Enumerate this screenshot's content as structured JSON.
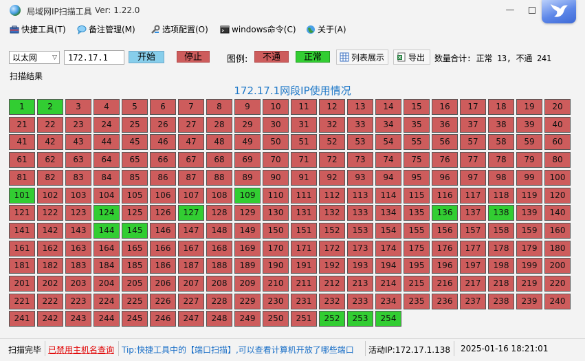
{
  "window": {
    "title": "局域网IP扫描工具",
    "version": "Ver: 1.22.0",
    "minimize_glyph": "—"
  },
  "menu": [
    {
      "label": "快捷工具(T)",
      "icon": "toolbox-icon"
    },
    {
      "label": "备注管理(M)",
      "icon": "chat-bubble-icon"
    },
    {
      "label": "选项配置(O)",
      "icon": "wrench-icon"
    },
    {
      "label": "windows命令(C)",
      "icon": "console-icon"
    },
    {
      "label": "关于(A)",
      "icon": "globe-icon"
    }
  ],
  "toolbar": {
    "adapter_selected": "以太网",
    "ip_value": "172.17.1",
    "start_label": "开始",
    "stop_label": "停止",
    "legend_label": "图例:",
    "legend_down": "不通",
    "legend_up": "正常",
    "list_view_label": "列表展示",
    "export_label": "导出",
    "count_text": "数量合计: 正常 13, 不通 241"
  },
  "results": {
    "section_label": "扫描结果",
    "grid_title": "172.17.1网段IP使用情况",
    "total": 254,
    "up_hosts": [
      1,
      2,
      101,
      109,
      124,
      127,
      136,
      138,
      144,
      145,
      252,
      253,
      254
    ]
  },
  "colors": {
    "up": "#32cd32",
    "down": "#cd5c5c",
    "start_button": "#87ceeb",
    "title_blue": "#1e78c8"
  },
  "status": {
    "state": "扫描完毕",
    "hostname_link": "已禁用主机名查询",
    "tip": "Tip:快捷工具中的【端口扫描】,可以查看计算机开放了哪些端口",
    "active_ip": "活动IP:172.17.1.138",
    "datetime": "2025-01-16 18:21:01"
  }
}
